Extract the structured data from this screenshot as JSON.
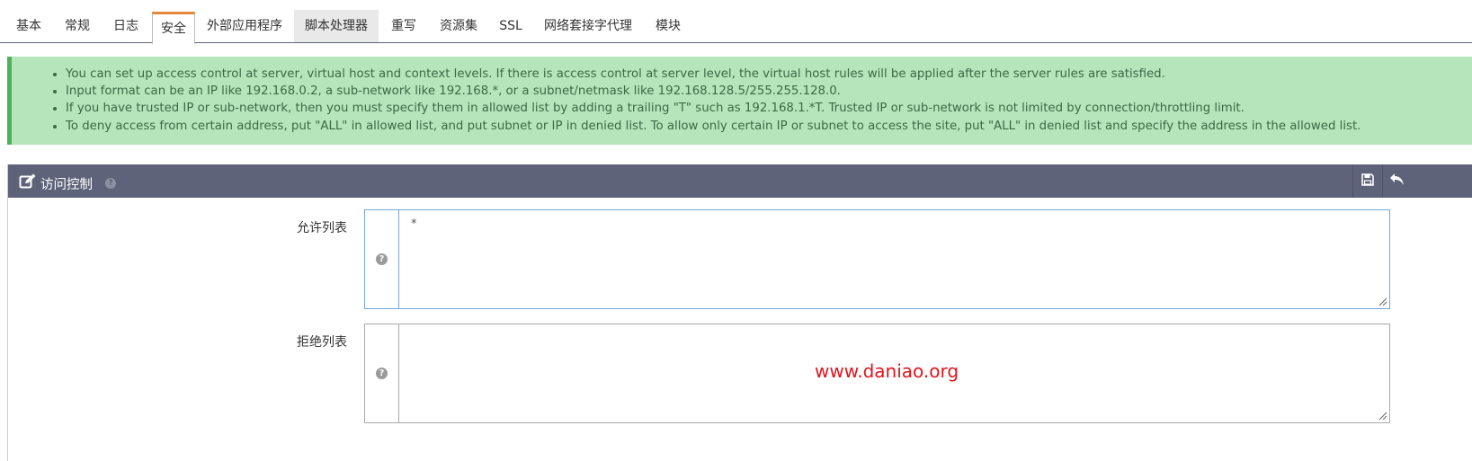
{
  "tabs": [
    {
      "label": "基本"
    },
    {
      "label": "常规"
    },
    {
      "label": "日志"
    },
    {
      "label": "安全"
    },
    {
      "label": "外部应用程序"
    },
    {
      "label": "脚本处理器"
    },
    {
      "label": "重写"
    },
    {
      "label": "资源集"
    },
    {
      "label": "SSL"
    },
    {
      "label": "网络套接字代理"
    },
    {
      "label": "模块"
    }
  ],
  "active_tab": "安全",
  "alert": {
    "items": [
      "You can set up access control at server, virtual host and context levels. If there is access control at server level, the virtual host rules will be applied after the server rules are satisfied.",
      "Input format can be an IP like 192.168.0.2, a sub-network like 192.168.*, or a subnet/netmask like 192.168.128.5/255.255.128.0.",
      "If you have trusted IP or sub-network, then you must specify them in allowed list by adding a trailing \"T\" such as 192.168.1.*T. Trusted IP or sub-network is not limited by connection/throttling limit.",
      "To deny access from certain address, put \"ALL\" in allowed list, and put subnet or IP in denied list. To allow only certain IP or subnet to access the site, put \"ALL\" in denied list and specify the address in the allowed list."
    ]
  },
  "panel": {
    "title": "访问控制",
    "icons": {
      "title_icon": "edit-icon",
      "save": "save-icon",
      "back": "undo-icon",
      "help": "help-icon"
    }
  },
  "fields": {
    "allow": {
      "label": "允许列表",
      "value": "*"
    },
    "deny": {
      "label": "拒绝列表",
      "value": ""
    }
  },
  "watermark": "www.daniao.org",
  "colors": {
    "accent": "#e4873a",
    "panel_header": "#5e6379",
    "alert_bg": "#b6e4bb",
    "alert_border": "#4cb35c",
    "watermark": "#e0141e"
  }
}
